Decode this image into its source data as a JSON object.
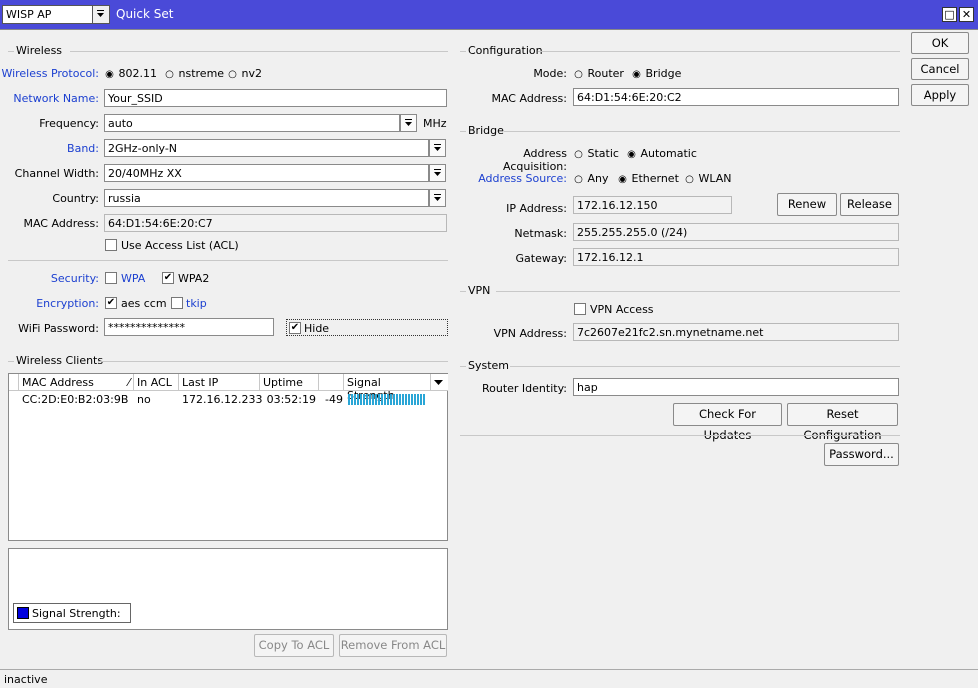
{
  "title_bar": {
    "mode_select": "WISP AP",
    "title": "Quick Set",
    "restore_glyph": "□",
    "close_glyph": "✕"
  },
  "buttons": {
    "ok": "OK",
    "cancel": "Cancel",
    "apply": "Apply",
    "renew": "Renew",
    "release": "Release",
    "check_updates": "Check For Updates",
    "reset_config": "Reset Configuration",
    "password": "Password...",
    "copy_acl": "Copy To ACL",
    "remove_acl": "Remove From ACL"
  },
  "wireless": {
    "section": "Wireless",
    "protocol_label": "Wireless Protocol:",
    "protocol_options": [
      "802.11",
      "nstreme",
      "nv2"
    ],
    "protocol_selected": "802.11",
    "network_name_label": "Network Name:",
    "network_name": "Your_SSID",
    "frequency_label": "Frequency:",
    "frequency": "auto",
    "frequency_unit": "MHz",
    "band_label": "Band:",
    "band": "2GHz-only-N",
    "channel_width_label": "Channel Width:",
    "channel_width": "20/40MHz XX",
    "country_label": "Country:",
    "country": "russia",
    "mac_label": "MAC Address:",
    "mac": "64:D1:54:6E:20:C7",
    "acl_label": "Use Access List (ACL)",
    "acl_checked": false,
    "security_label": "Security:",
    "wpa": "WPA",
    "wpa_checked": false,
    "wpa2": "WPA2",
    "wpa2_checked": true,
    "encryption_label": "Encryption:",
    "aes": "aes ccm",
    "aes_checked": true,
    "tkip": "tkip",
    "tkip_checked": false,
    "password_label": "WiFi Password:",
    "password": "**************",
    "hide": "Hide",
    "hide_checked": true
  },
  "clients": {
    "section": "Wireless Clients",
    "columns": [
      "MAC Address",
      "In ACL",
      "Last IP",
      "Uptime",
      "",
      "Signal Strength"
    ],
    "rows": [
      {
        "mac": "CC:2D:E0:B2:03:9B",
        "in_acl": "no",
        "last_ip": "172.16.12.233",
        "uptime": "03:52:19",
        "signal": "-49"
      }
    ],
    "legend": "Signal Strength:",
    "signal_color": "#0000dd",
    "bar_color": "#2aa6d6"
  },
  "configuration": {
    "section": "Configuration",
    "mode_label": "Mode:",
    "mode_options": [
      "Router",
      "Bridge"
    ],
    "mode_selected": "Bridge",
    "mac_label": "MAC Address:",
    "mac": "64:D1:54:6E:20:C2"
  },
  "bridge": {
    "section": "Bridge",
    "acq_label": "Address Acquisition:",
    "acq_options": [
      "Static",
      "Automatic"
    ],
    "acq_selected": "Automatic",
    "source_label": "Address Source:",
    "source_options": [
      "Any",
      "Ethernet",
      "WLAN"
    ],
    "source_selected": "Ethernet",
    "ip_label": "IP Address:",
    "ip": "172.16.12.150",
    "netmask_label": "Netmask:",
    "netmask": "255.255.255.0 (/24)",
    "gateway_label": "Gateway:",
    "gateway": "172.16.12.1"
  },
  "vpn": {
    "section": "VPN",
    "access_label": "VPN Access",
    "access_checked": false,
    "address_label": "VPN Address:",
    "address": "7c2607e21fc2.sn.mynetname.net"
  },
  "system": {
    "section": "System",
    "identity_label": "Router Identity:",
    "identity": "hap"
  },
  "status": "inactive"
}
